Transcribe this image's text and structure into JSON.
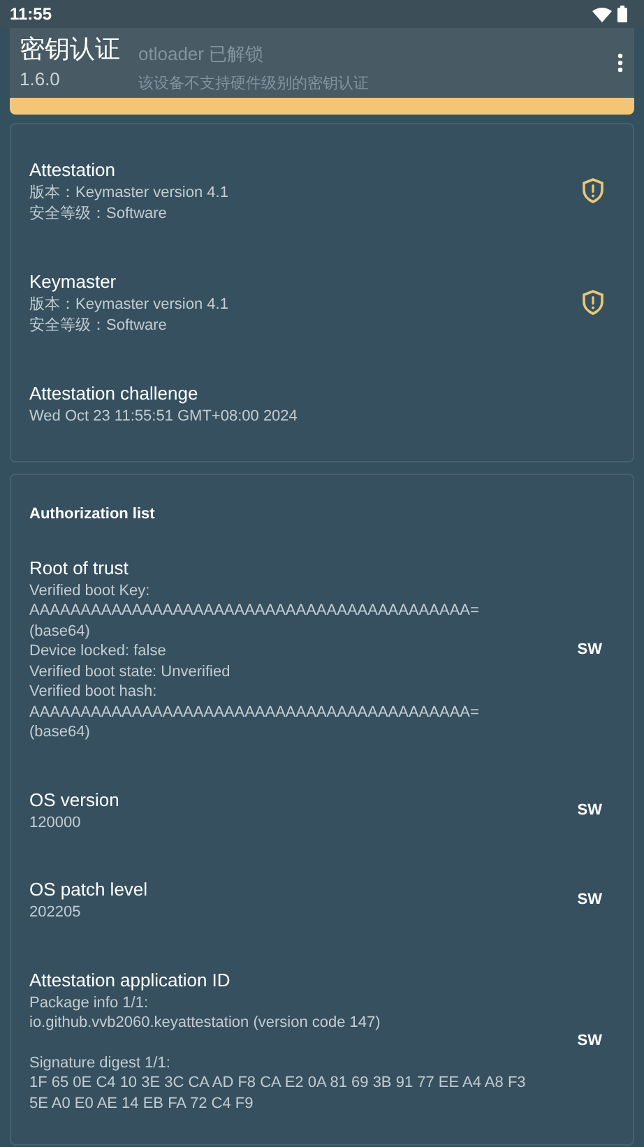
{
  "status_bar": {
    "time": "11:55"
  },
  "app_bar": {
    "title": "密钥认证",
    "subtitle": "1.6.0"
  },
  "banner": {
    "title": "otloader 已解锁",
    "message": "该设备不支持硬件级别的密钥认证"
  },
  "attestation_card": {
    "items": [
      {
        "title": "Attestation",
        "lines": [
          "版本：Keymaster version 4.1",
          "安全等级：Software"
        ],
        "warning": true
      },
      {
        "title": "Keymaster",
        "lines": [
          "版本：Keymaster version 4.1",
          "安全等级：Software"
        ],
        "warning": true
      },
      {
        "title": "Attestation challenge",
        "lines": [
          "Wed Oct 23 11:55:51 GMT+08:00 2024"
        ],
        "warning": false
      }
    ]
  },
  "authorization_card": {
    "heading": "Authorization list",
    "items": [
      {
        "title": "Root of trust",
        "lines": [
          "Verified boot Key:",
          "AAAAAAAAAAAAAAAAAAAAAAAAAAAAAAAAAAAAAAAAAAA=",
          "(base64)",
          "Device locked: false",
          "Verified boot state: Unverified",
          "Verified boot hash:",
          "AAAAAAAAAAAAAAAAAAAAAAAAAAAAAAAAAAAAAAAAAAA=",
          "(base64)"
        ],
        "badge": "SW"
      },
      {
        "title": "OS version",
        "lines": [
          "120000"
        ],
        "badge": "SW"
      },
      {
        "title": "OS patch level",
        "lines": [
          "202205"
        ],
        "badge": "SW"
      },
      {
        "title": "Attestation application ID",
        "lines": [
          "Package info 1/1:",
          "io.github.vvb2060.keyattestation (version code 147)"
        ],
        "more_lines": [
          "Signature digest 1/1:",
          "1F 65 0E C4 10 3E 3C CA AD F8 CA E2 0A 81 69 3B 91 77 EE A4 A8 F3",
          "5E A0 E0 AE 14 EB FA 72 C4 F9"
        ],
        "badge": "SW"
      }
    ]
  }
}
